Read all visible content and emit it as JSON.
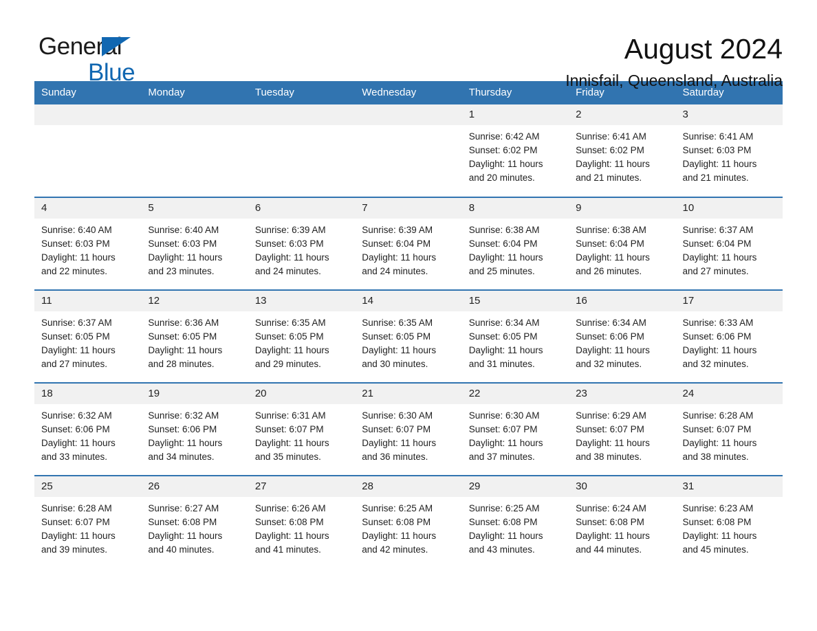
{
  "brand": {
    "name_part1": "General",
    "name_part2": "Blue",
    "accent_color": "#1167b1"
  },
  "header": {
    "title": "August 2024",
    "subtitle": "Innisfail, Queensland, Australia",
    "header_bg_color": "#3174b0",
    "daynum_bg_color": "#f1f1f1"
  },
  "weekdays": [
    "Sunday",
    "Monday",
    "Tuesday",
    "Wednesday",
    "Thursday",
    "Friday",
    "Saturday"
  ],
  "weeks": [
    [
      {
        "day": "",
        "sunrise": "",
        "sunset": "",
        "daylight_line1": "",
        "daylight_line2": "",
        "empty": true
      },
      {
        "day": "",
        "sunrise": "",
        "sunset": "",
        "daylight_line1": "",
        "daylight_line2": "",
        "empty": true
      },
      {
        "day": "",
        "sunrise": "",
        "sunset": "",
        "daylight_line1": "",
        "daylight_line2": "",
        "empty": true
      },
      {
        "day": "",
        "sunrise": "",
        "sunset": "",
        "daylight_line1": "",
        "daylight_line2": "",
        "empty": true
      },
      {
        "day": "1",
        "sunrise": "Sunrise: 6:42 AM",
        "sunset": "Sunset: 6:02 PM",
        "daylight_line1": "Daylight: 11 hours",
        "daylight_line2": "and 20 minutes."
      },
      {
        "day": "2",
        "sunrise": "Sunrise: 6:41 AM",
        "sunset": "Sunset: 6:02 PM",
        "daylight_line1": "Daylight: 11 hours",
        "daylight_line2": "and 21 minutes."
      },
      {
        "day": "3",
        "sunrise": "Sunrise: 6:41 AM",
        "sunset": "Sunset: 6:03 PM",
        "daylight_line1": "Daylight: 11 hours",
        "daylight_line2": "and 21 minutes."
      }
    ],
    [
      {
        "day": "4",
        "sunrise": "Sunrise: 6:40 AM",
        "sunset": "Sunset: 6:03 PM",
        "daylight_line1": "Daylight: 11 hours",
        "daylight_line2": "and 22 minutes."
      },
      {
        "day": "5",
        "sunrise": "Sunrise: 6:40 AM",
        "sunset": "Sunset: 6:03 PM",
        "daylight_line1": "Daylight: 11 hours",
        "daylight_line2": "and 23 minutes."
      },
      {
        "day": "6",
        "sunrise": "Sunrise: 6:39 AM",
        "sunset": "Sunset: 6:03 PM",
        "daylight_line1": "Daylight: 11 hours",
        "daylight_line2": "and 24 minutes."
      },
      {
        "day": "7",
        "sunrise": "Sunrise: 6:39 AM",
        "sunset": "Sunset: 6:04 PM",
        "daylight_line1": "Daylight: 11 hours",
        "daylight_line2": "and 24 minutes."
      },
      {
        "day": "8",
        "sunrise": "Sunrise: 6:38 AM",
        "sunset": "Sunset: 6:04 PM",
        "daylight_line1": "Daylight: 11 hours",
        "daylight_line2": "and 25 minutes."
      },
      {
        "day": "9",
        "sunrise": "Sunrise: 6:38 AM",
        "sunset": "Sunset: 6:04 PM",
        "daylight_line1": "Daylight: 11 hours",
        "daylight_line2": "and 26 minutes."
      },
      {
        "day": "10",
        "sunrise": "Sunrise: 6:37 AM",
        "sunset": "Sunset: 6:04 PM",
        "daylight_line1": "Daylight: 11 hours",
        "daylight_line2": "and 27 minutes."
      }
    ],
    [
      {
        "day": "11",
        "sunrise": "Sunrise: 6:37 AM",
        "sunset": "Sunset: 6:05 PM",
        "daylight_line1": "Daylight: 11 hours",
        "daylight_line2": "and 27 minutes."
      },
      {
        "day": "12",
        "sunrise": "Sunrise: 6:36 AM",
        "sunset": "Sunset: 6:05 PM",
        "daylight_line1": "Daylight: 11 hours",
        "daylight_line2": "and 28 minutes."
      },
      {
        "day": "13",
        "sunrise": "Sunrise: 6:35 AM",
        "sunset": "Sunset: 6:05 PM",
        "daylight_line1": "Daylight: 11 hours",
        "daylight_line2": "and 29 minutes."
      },
      {
        "day": "14",
        "sunrise": "Sunrise: 6:35 AM",
        "sunset": "Sunset: 6:05 PM",
        "daylight_line1": "Daylight: 11 hours",
        "daylight_line2": "and 30 minutes."
      },
      {
        "day": "15",
        "sunrise": "Sunrise: 6:34 AM",
        "sunset": "Sunset: 6:05 PM",
        "daylight_line1": "Daylight: 11 hours",
        "daylight_line2": "and 31 minutes."
      },
      {
        "day": "16",
        "sunrise": "Sunrise: 6:34 AM",
        "sunset": "Sunset: 6:06 PM",
        "daylight_line1": "Daylight: 11 hours",
        "daylight_line2": "and 32 minutes."
      },
      {
        "day": "17",
        "sunrise": "Sunrise: 6:33 AM",
        "sunset": "Sunset: 6:06 PM",
        "daylight_line1": "Daylight: 11 hours",
        "daylight_line2": "and 32 minutes."
      }
    ],
    [
      {
        "day": "18",
        "sunrise": "Sunrise: 6:32 AM",
        "sunset": "Sunset: 6:06 PM",
        "daylight_line1": "Daylight: 11 hours",
        "daylight_line2": "and 33 minutes."
      },
      {
        "day": "19",
        "sunrise": "Sunrise: 6:32 AM",
        "sunset": "Sunset: 6:06 PM",
        "daylight_line1": "Daylight: 11 hours",
        "daylight_line2": "and 34 minutes."
      },
      {
        "day": "20",
        "sunrise": "Sunrise: 6:31 AM",
        "sunset": "Sunset: 6:07 PM",
        "daylight_line1": "Daylight: 11 hours",
        "daylight_line2": "and 35 minutes."
      },
      {
        "day": "21",
        "sunrise": "Sunrise: 6:30 AM",
        "sunset": "Sunset: 6:07 PM",
        "daylight_line1": "Daylight: 11 hours",
        "daylight_line2": "and 36 minutes."
      },
      {
        "day": "22",
        "sunrise": "Sunrise: 6:30 AM",
        "sunset": "Sunset: 6:07 PM",
        "daylight_line1": "Daylight: 11 hours",
        "daylight_line2": "and 37 minutes."
      },
      {
        "day": "23",
        "sunrise": "Sunrise: 6:29 AM",
        "sunset": "Sunset: 6:07 PM",
        "daylight_line1": "Daylight: 11 hours",
        "daylight_line2": "and 38 minutes."
      },
      {
        "day": "24",
        "sunrise": "Sunrise: 6:28 AM",
        "sunset": "Sunset: 6:07 PM",
        "daylight_line1": "Daylight: 11 hours",
        "daylight_line2": "and 38 minutes."
      }
    ],
    [
      {
        "day": "25",
        "sunrise": "Sunrise: 6:28 AM",
        "sunset": "Sunset: 6:07 PM",
        "daylight_line1": "Daylight: 11 hours",
        "daylight_line2": "and 39 minutes."
      },
      {
        "day": "26",
        "sunrise": "Sunrise: 6:27 AM",
        "sunset": "Sunset: 6:08 PM",
        "daylight_line1": "Daylight: 11 hours",
        "daylight_line2": "and 40 minutes."
      },
      {
        "day": "27",
        "sunrise": "Sunrise: 6:26 AM",
        "sunset": "Sunset: 6:08 PM",
        "daylight_line1": "Daylight: 11 hours",
        "daylight_line2": "and 41 minutes."
      },
      {
        "day": "28",
        "sunrise": "Sunrise: 6:25 AM",
        "sunset": "Sunset: 6:08 PM",
        "daylight_line1": "Daylight: 11 hours",
        "daylight_line2": "and 42 minutes."
      },
      {
        "day": "29",
        "sunrise": "Sunrise: 6:25 AM",
        "sunset": "Sunset: 6:08 PM",
        "daylight_line1": "Daylight: 11 hours",
        "daylight_line2": "and 43 minutes."
      },
      {
        "day": "30",
        "sunrise": "Sunrise: 6:24 AM",
        "sunset": "Sunset: 6:08 PM",
        "daylight_line1": "Daylight: 11 hours",
        "daylight_line2": "and 44 minutes."
      },
      {
        "day": "31",
        "sunrise": "Sunrise: 6:23 AM",
        "sunset": "Sunset: 6:08 PM",
        "daylight_line1": "Daylight: 11 hours",
        "daylight_line2": "and 45 minutes."
      }
    ]
  ]
}
